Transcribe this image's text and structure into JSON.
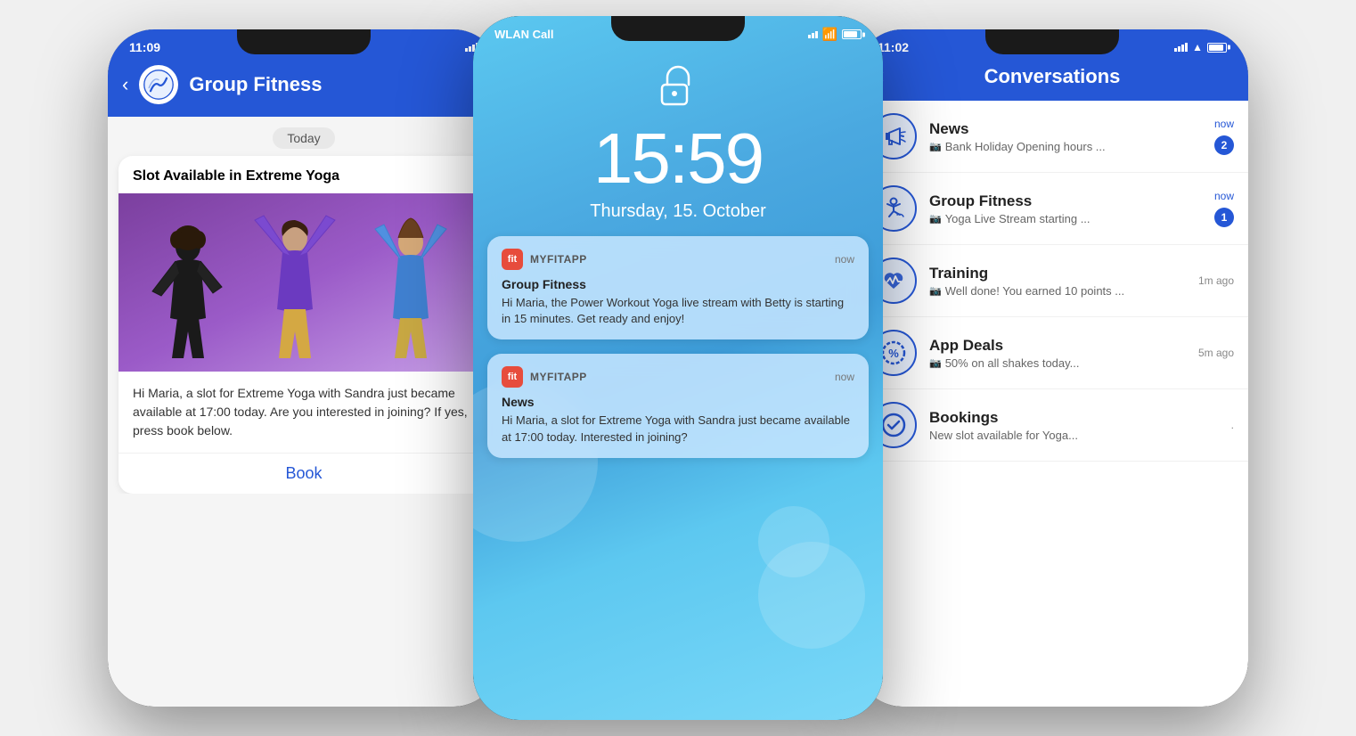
{
  "phone1": {
    "status": {
      "time": "11:09",
      "location": "↗"
    },
    "header": {
      "back": "‹",
      "title": "Group Fitness"
    },
    "today_label": "Today",
    "card": {
      "title": "Slot Available in Extreme Yoga",
      "body": "Hi Maria, a slot for Extreme Yoga with Sandra just became available at 17:00 today.\nAre you interested in joining? If yes, press book below.",
      "book_label": "Book"
    }
  },
  "phone2": {
    "status": {
      "carrier": "WLAN Call"
    },
    "lock_icon": "🔓",
    "time": "15:59",
    "date": "Thursday, 15. October",
    "notifications": [
      {
        "app_icon": "fit",
        "app_name": "MYFITAPP",
        "time": "now",
        "title": "Group Fitness",
        "body": "Hi Maria, the Power Workout Yoga live stream with Betty is starting in 15 minutes. Get ready and enjoy!"
      },
      {
        "app_icon": "fit",
        "app_name": "MYFITAPP",
        "time": "now",
        "title": "News",
        "body": "Hi Maria, a slot for Extreme Yoga with Sandra just became available at 17:00 today. Interested in joining?"
      }
    ]
  },
  "phone3": {
    "status": {
      "time": "11:02",
      "location": "↗"
    },
    "header": {
      "close": "✕",
      "title": "Conversations"
    },
    "conversations": [
      {
        "name": "News",
        "preview": "Bank Holiday Opening hours ...",
        "time": "now",
        "badge": "2",
        "icon": "megaphone"
      },
      {
        "name": "Group Fitness",
        "preview": "Yoga Live Stream starting ...",
        "time": "now",
        "badge": "1",
        "icon": "yoga"
      },
      {
        "name": "Training",
        "preview": "Well done! You earned 10 points ...",
        "time": "1m ago",
        "badge": "",
        "icon": "heart-rate"
      },
      {
        "name": "App Deals",
        "preview": "50% on all shakes today...",
        "time": "5m ago",
        "badge": "",
        "icon": "percent"
      },
      {
        "name": "Bookings",
        "preview": "New slot available for Yoga...",
        "time": ".",
        "badge": "",
        "icon": "checkmark"
      }
    ]
  }
}
